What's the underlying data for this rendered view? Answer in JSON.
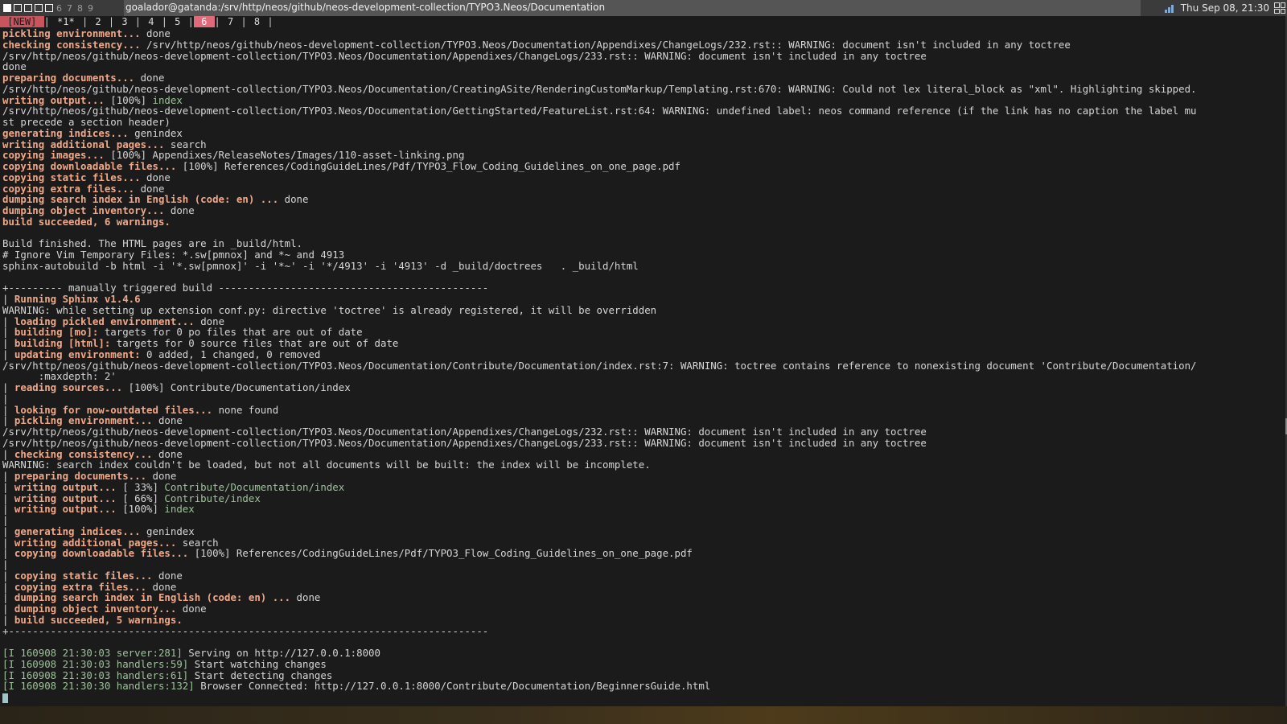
{
  "topbar": {
    "workspaces": [
      {
        "label": "1",
        "active": true,
        "box": true
      },
      {
        "label": "2",
        "active": false,
        "box": true
      },
      {
        "label": "3",
        "active": false,
        "box": true
      },
      {
        "label": "4",
        "active": false,
        "box": true
      },
      {
        "label": "5",
        "active": false,
        "box": true
      },
      {
        "label": "6",
        "active": false,
        "box": false
      },
      {
        "label": "7",
        "active": false,
        "box": false
      },
      {
        "label": "8",
        "active": false,
        "box": false
      },
      {
        "label": "9",
        "active": false,
        "box": false
      }
    ],
    "window_title": "goalador@gatanda:/srv/http/neos/github/neos-development-collection/TYPO3.Neos/Documentation",
    "clock": "Thu Sep 08, 21:30",
    "icons": [
      "signal-icon",
      "layout-grid-icon"
    ]
  },
  "tmux_tabs": [
    "[NEW]",
    "*1*",
    "2",
    "3",
    "4",
    "5",
    "6",
    "7",
    "8"
  ],
  "selected_tab": "6",
  "terminal_lines": [
    [
      {
        "t": "pickling environment... ",
        "s": "b"
      },
      {
        "t": "done",
        "s": "w"
      }
    ],
    [
      {
        "t": "checking consistency... ",
        "s": "b"
      },
      {
        "t": "/srv/http/neos/github/neos-development-collection/TYPO3.Neos/Documentation/Appendixes/ChangeLogs/232.rst:: WARNING: document isn't included in any toctree",
        "s": "w"
      }
    ],
    [
      {
        "t": "/srv/http/neos/github/neos-development-collection/TYPO3.Neos/Documentation/Appendixes/ChangeLogs/233.rst:: WARNING: document isn't included in any toctree",
        "s": "w"
      }
    ],
    [
      {
        "t": "done",
        "s": "w"
      }
    ],
    [
      {
        "t": "preparing documents... ",
        "s": "b"
      },
      {
        "t": "done",
        "s": "w"
      }
    ],
    [
      {
        "t": "/srv/http/neos/github/neos-development-collection/TYPO3.Neos/Documentation/CreatingASite/RenderingCustomMarkup/Templating.rst:670: WARNING: Could not lex literal_block as \"xml\". Highlighting skipped.",
        "s": "w"
      }
    ],
    [
      {
        "t": "writing output... ",
        "s": "b"
      },
      {
        "t": "[100%] ",
        "s": "w"
      },
      {
        "t": "index",
        "s": "g"
      }
    ],
    [
      {
        "t": "/srv/http/neos/github/neos-development-collection/TYPO3.Neos/Documentation/GettingStarted/FeatureList.rst:64: WARNING: undefined label: neos command reference (if the link has no caption the label mu",
        "s": "w"
      }
    ],
    [
      {
        "t": "st precede a section header)",
        "s": "w"
      }
    ],
    [
      {
        "t": "generating indices... ",
        "s": "b"
      },
      {
        "t": "genindex",
        "s": "w"
      }
    ],
    [
      {
        "t": "writing additional pages... ",
        "s": "b"
      },
      {
        "t": "search",
        "s": "w"
      }
    ],
    [
      {
        "t": "copying images... ",
        "s": "b"
      },
      {
        "t": "[100%] Appendixes/ReleaseNotes/Images/110-asset-linking.png",
        "s": "w"
      }
    ],
    [
      {
        "t": "copying downloadable files... ",
        "s": "b"
      },
      {
        "t": "[100%] References/CodingGuideLines/Pdf/TYPO3_Flow_Coding_Guidelines_on_one_page.pdf",
        "s": "w"
      }
    ],
    [
      {
        "t": "copying static files... ",
        "s": "b"
      },
      {
        "t": "done",
        "s": "w"
      }
    ],
    [
      {
        "t": "copying extra files... ",
        "s": "b"
      },
      {
        "t": "done",
        "s": "w"
      }
    ],
    [
      {
        "t": "dumping search index in English (code: en) ... ",
        "s": "b"
      },
      {
        "t": "done",
        "s": "w"
      }
    ],
    [
      {
        "t": "dumping object inventory... ",
        "s": "b"
      },
      {
        "t": "done",
        "s": "w"
      }
    ],
    [
      {
        "t": "build succeeded, 6 warnings.",
        "s": "b"
      }
    ],
    [],
    [
      {
        "t": "Build finished. The HTML pages are in _build/html.",
        "s": "w"
      }
    ],
    [
      {
        "t": "# Ignore Vim Temporary Files: *.sw[pmnox] and *~ and 4913",
        "s": "w"
      }
    ],
    [
      {
        "t": "sphinx-autobuild -b html -i '*.sw[pmnox]' -i '*~' -i '*/4913' -i '4913' -d _build/doctrees   . _build/html",
        "s": "w"
      }
    ],
    [],
    [
      {
        "t": "+--------- manually triggered build ---------------------------------------------",
        "s": "w"
      }
    ],
    [
      {
        "t": "| ",
        "s": "w"
      },
      {
        "t": "Running Sphinx v1.4.6",
        "s": "b"
      }
    ],
    [
      {
        "t": "WARNING: while setting up extension conf.py: directive 'toctree' is already registered, it will be overridden",
        "s": "w"
      }
    ],
    [
      {
        "t": "| ",
        "s": "w"
      },
      {
        "t": "loading pickled environment... ",
        "s": "b"
      },
      {
        "t": "done",
        "s": "w"
      }
    ],
    [
      {
        "t": "| ",
        "s": "w"
      },
      {
        "t": "building [mo]: ",
        "s": "b"
      },
      {
        "t": "targets for 0 po files that are out of date",
        "s": "w"
      }
    ],
    [
      {
        "t": "| ",
        "s": "w"
      },
      {
        "t": "building [html]: ",
        "s": "b"
      },
      {
        "t": "targets for 0 source files that are out of date",
        "s": "w"
      }
    ],
    [
      {
        "t": "| ",
        "s": "w"
      },
      {
        "t": "updating environment: ",
        "s": "b"
      },
      {
        "t": "0 added, 1 changed, 0 removed",
        "s": "w"
      }
    ],
    [
      {
        "t": "/srv/http/neos/github/neos-development-collection/TYPO3.Neos/Documentation/Contribute/Documentation/index.rst:7: WARNING: toctree contains reference to nonexisting document 'Contribute/Documentation/",
        "s": "w"
      }
    ],
    [
      {
        "t": "      :maxdepth: 2'",
        "s": "w"
      }
    ],
    [
      {
        "t": "| ",
        "s": "w"
      },
      {
        "t": "reading sources... ",
        "s": "b"
      },
      {
        "t": "[100%] Contribute/Documentation/index",
        "s": "w"
      }
    ],
    [
      {
        "t": "|",
        "s": "w"
      }
    ],
    [
      {
        "t": "| ",
        "s": "w"
      },
      {
        "t": "looking for now-outdated files... ",
        "s": "b"
      },
      {
        "t": "none found",
        "s": "w"
      }
    ],
    [
      {
        "t": "| ",
        "s": "w"
      },
      {
        "t": "pickling environment... ",
        "s": "b"
      },
      {
        "t": "done",
        "s": "w"
      }
    ],
    [
      {
        "t": "/srv/http/neos/github/neos-development-collection/TYPO3.Neos/Documentation/Appendixes/ChangeLogs/232.rst:: WARNING: document isn't included in any toctree",
        "s": "w"
      }
    ],
    [
      {
        "t": "/srv/http/neos/github/neos-development-collection/TYPO3.Neos/Documentation/Appendixes/ChangeLogs/233.rst:: WARNING: document isn't included in any toctree",
        "s": "w"
      }
    ],
    [
      {
        "t": "| ",
        "s": "w"
      },
      {
        "t": "checking consistency... ",
        "s": "b"
      },
      {
        "t": "done",
        "s": "w"
      }
    ],
    [
      {
        "t": "WARNING: search index couldn't be loaded, but not all documents will be built: the index will be incomplete.",
        "s": "w"
      }
    ],
    [
      {
        "t": "| ",
        "s": "w"
      },
      {
        "t": "preparing documents... ",
        "s": "b"
      },
      {
        "t": "done",
        "s": "w"
      }
    ],
    [
      {
        "t": "| ",
        "s": "w"
      },
      {
        "t": "writing output... ",
        "s": "b"
      },
      {
        "t": "[ 33%] ",
        "s": "w"
      },
      {
        "t": "Contribute/Documentation/index",
        "s": "g"
      }
    ],
    [
      {
        "t": "| ",
        "s": "w"
      },
      {
        "t": "writing output... ",
        "s": "b"
      },
      {
        "t": "[ 66%] ",
        "s": "w"
      },
      {
        "t": "Contribute/index",
        "s": "g"
      }
    ],
    [
      {
        "t": "| ",
        "s": "w"
      },
      {
        "t": "writing output... ",
        "s": "b"
      },
      {
        "t": "[100%] ",
        "s": "w"
      },
      {
        "t": "index",
        "s": "g"
      }
    ],
    [
      {
        "t": "|",
        "s": "w"
      }
    ],
    [
      {
        "t": "| ",
        "s": "w"
      },
      {
        "t": "generating indices... ",
        "s": "b"
      },
      {
        "t": "genindex",
        "s": "w"
      }
    ],
    [
      {
        "t": "| ",
        "s": "w"
      },
      {
        "t": "writing additional pages... ",
        "s": "b"
      },
      {
        "t": "search",
        "s": "w"
      }
    ],
    [
      {
        "t": "| ",
        "s": "w"
      },
      {
        "t": "copying downloadable files... ",
        "s": "b"
      },
      {
        "t": "[100%] References/CodingGuideLines/Pdf/TYPO3_Flow_Coding_Guidelines_on_one_page.pdf",
        "s": "w"
      }
    ],
    [
      {
        "t": "|",
        "s": "w"
      }
    ],
    [
      {
        "t": "| ",
        "s": "w"
      },
      {
        "t": "copying static files... ",
        "s": "b"
      },
      {
        "t": "done",
        "s": "w"
      }
    ],
    [
      {
        "t": "| ",
        "s": "w"
      },
      {
        "t": "copying extra files... ",
        "s": "b"
      },
      {
        "t": "done",
        "s": "w"
      }
    ],
    [
      {
        "t": "| ",
        "s": "w"
      },
      {
        "t": "dumping search index in English (code: en) ... ",
        "s": "b"
      },
      {
        "t": "done",
        "s": "w"
      }
    ],
    [
      {
        "t": "| ",
        "s": "w"
      },
      {
        "t": "dumping object inventory... ",
        "s": "b"
      },
      {
        "t": "done",
        "s": "w"
      }
    ],
    [
      {
        "t": "| ",
        "s": "w"
      },
      {
        "t": "build succeeded, 5 warnings.",
        "s": "b"
      }
    ],
    [
      {
        "t": "+--------------------------------------------------------------------------------",
        "s": "w"
      }
    ],
    [],
    [
      {
        "t": "[I 160908 21:30:03 server:281] ",
        "s": "g"
      },
      {
        "t": "Serving on http://127.0.0.1:8000",
        "s": "w"
      }
    ],
    [
      {
        "t": "[I 160908 21:30:03 handlers:59] ",
        "s": "g"
      },
      {
        "t": "Start watching changes",
        "s": "w"
      }
    ],
    [
      {
        "t": "[I 160908 21:30:03 handlers:61] ",
        "s": "g"
      },
      {
        "t": "Start detecting changes",
        "s": "w"
      }
    ],
    [
      {
        "t": "[I 160908 21:30:30 handlers:132] ",
        "s": "g"
      },
      {
        "t": "Browser Connected: http://127.0.0.1:8000/Contribute/Documentation/BeginnersGuide.html",
        "s": "w"
      }
    ]
  ],
  "colors": {
    "bold_label": "#f0a888",
    "highlight_green": "#9dc29a",
    "terminal_bg": "#1b1b1b",
    "tab_selected": "#e06a7a"
  }
}
